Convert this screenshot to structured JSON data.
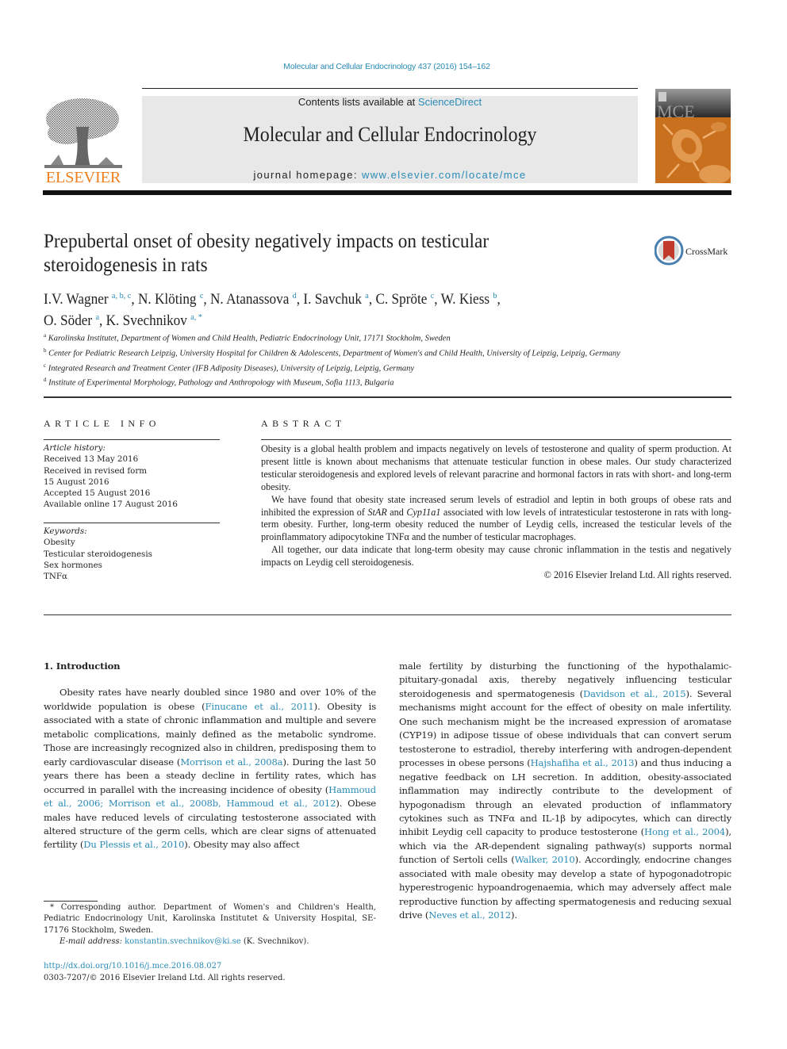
{
  "header": {
    "running_head": "Molecular and Cellular Endocrinology 437 (2016) 154–162",
    "publisher_logo_text": "ELSEVIER",
    "contents_prefix": "Contents lists available at ",
    "contents_link": "ScienceDirect",
    "journal_title": "Molecular and Cellular Endocrinology",
    "homepage_prefix": "journal homepage: ",
    "homepage_link": "www.elsevier.com/locate/mce",
    "cover_label": "MCE",
    "crossmark_label": "CrossMark",
    "colors": {
      "link": "#2a8bb6",
      "elsevier_orange": "#f07e1b",
      "cover_orange": "#c8701e"
    }
  },
  "article": {
    "title": "Prepubertal onset of obesity negatively impacts on testicular steroidogenesis in rats",
    "authors": [
      {
        "name": "I.V. Wagner",
        "sup": "a, b, c"
      },
      {
        "name": "N. Klöting",
        "sup": "c"
      },
      {
        "name": "N. Atanassova",
        "sup": "d"
      },
      {
        "name": "I. Savchuk",
        "sup": "a"
      },
      {
        "name": "C. Spröte",
        "sup": "c"
      },
      {
        "name": "W. Kiess",
        "sup": "b"
      },
      {
        "name": "O. Söder",
        "sup": "a"
      },
      {
        "name": "K. Svechnikov",
        "sup": "a, *"
      }
    ],
    "affiliations": [
      {
        "key": "a",
        "text": "Karolinska Institutet, Department of Women and Child Health, Pediatric Endocrinology Unit, 17171 Stockholm, Sweden"
      },
      {
        "key": "b",
        "text": "Center for Pediatric Research Leipzig, University Hospital for Children & Adolescents, Department of Women's and Child Health, University of Leipzig, Leipzig, Germany"
      },
      {
        "key": "c",
        "text": "Integrated Research and Treatment Center (IFB Adiposity Diseases), University of Leipzig, Leipzig, Germany"
      },
      {
        "key": "d",
        "text": "Institute of Experimental Morphology, Pathology and Anthropology with Museum, Sofia 1113, Bulgaria"
      }
    ]
  },
  "article_info": {
    "heading": "ARTICLE INFO",
    "history_label": "Article history:",
    "history": [
      "Received 13 May 2016",
      "Received in revised form",
      "15 August 2016",
      "Accepted 15 August 2016",
      "Available online 17 August 2016"
    ],
    "keywords_label": "Keywords:",
    "keywords": [
      "Obesity",
      "Testicular steroidogenesis",
      "Sex hormones",
      "TNFα"
    ]
  },
  "abstract": {
    "heading": "ABSTRACT",
    "p1": "Obesity is a global health problem and impacts negatively on levels of testosterone and quality of sperm production. At present little is known about mechanisms that attenuate testicular function in obese males. Our study characterized testicular steroidogenesis and explored levels of relevant paracrine and hormonal factors in rats with short- and long-term obesity.",
    "p2_a": "We have found that obesity state increased serum levels of estradiol and leptin in both groups of obese rats and inhibited the expression of ",
    "p2_gene1": "StAR",
    "p2_b": " and ",
    "p2_gene2": "Cyp11a1",
    "p2_c": " associated with low levels of intratesticular testosterone in rats with long-term obesity. Further, long-term obesity reduced the number of Leydig cells, increased the testicular levels of the proinflammatory adipocytokine TNFα and the number of testicular macrophages.",
    "p3": "All together, our data indicate that long-term obesity may cause chronic inflammation in the testis and negatively impacts on Leydig cell steroidogenesis.",
    "copyright": "© 2016 Elsevier Ireland Ltd. All rights reserved."
  },
  "body": {
    "section_heading": "1.  Introduction",
    "left": [
      {
        "t": "Obesity rates have nearly doubled since 1980 and over 10% of the worldwide population is obese ("
      },
      {
        "link": "Finucane et al., 2011"
      },
      {
        "t": "). Obesity is associated with a state of chronic inflammation and multiple and severe metabolic complications, mainly defined as the metabolic syndrome. Those are increasingly recognized also in children, predisposing them to early cardiovascular disease ("
      },
      {
        "link": "Morrison et al., 2008a"
      },
      {
        "t": "). During the last 50 years there has been a steady decline in fertility rates, which has occurred in parallel with the increasing incidence of obesity ("
      },
      {
        "link": "Hammoud et al., 2006; Morrison et al., 2008b, Hammoud et al., 2012"
      },
      {
        "t": "). Obese males have reduced levels of circulating testosterone associated with altered structure of the germ cells, which are clear signs of attenuated fertility ("
      },
      {
        "link": "Du Plessis et al., 2010"
      },
      {
        "t": "). Obesity may also affect"
      }
    ],
    "right": [
      {
        "t": "male fertility by disturbing the functioning of the hypothalamic-pituitary-gonadal axis, thereby negatively influencing testicular steroidogenesis and spermatogenesis ("
      },
      {
        "link": "Davidson et al., 2015"
      },
      {
        "t": "). Several mechanisms might account for the effect of obesity on male infertility. One such mechanism might be the increased expression of aromatase (CYP19) in adipose tissue of obese individuals that can convert serum testosterone to estradiol, thereby interfering with androgen-dependent processes in obese persons ("
      },
      {
        "link": "Hajshafiha et al., 2013"
      },
      {
        "t": ") and thus inducing a negative feedback on LH secretion. In addition, obesity-associated inflammation may indirectly contribute to the development of hypogonadism through an elevated production of inflammatory cytokines such as TNFα and IL-1β by adipocytes, which can directly inhibit Leydig cell capacity to produce testosterone ("
      },
      {
        "link": "Hong et al., 2004"
      },
      {
        "t": "), which via the AR-dependent signaling pathway(s) supports normal function of Sertoli cells ("
      },
      {
        "link": "Walker, 2010"
      },
      {
        "t": "). Accordingly, endocrine changes associated with male obesity may develop a state of hypogonadotropic hyperestrogenic hypoandrogenaemia, which may adversely affect male reproductive function by affecting spermatogenesis and reducing sexual drive ("
      },
      {
        "link": "Neves et al., 2012"
      },
      {
        "t": ")."
      }
    ]
  },
  "footnote": {
    "corresponding": "* Corresponding author. Department of Women's and Children's Health, Pediatric Endocrinology Unit, Karolinska Institutet & University Hospital, SE-17176 Stockholm, Sweden.",
    "email_label": "E-mail address: ",
    "email": "konstantin.svechnikov@ki.se",
    "email_suffix": " (K. Svechnikov)."
  },
  "doi": {
    "link": "http://dx.doi.org/10.1016/j.mce.2016.08.027",
    "issn_line": "0303-7207/© 2016 Elsevier Ireland Ltd. All rights reserved."
  }
}
